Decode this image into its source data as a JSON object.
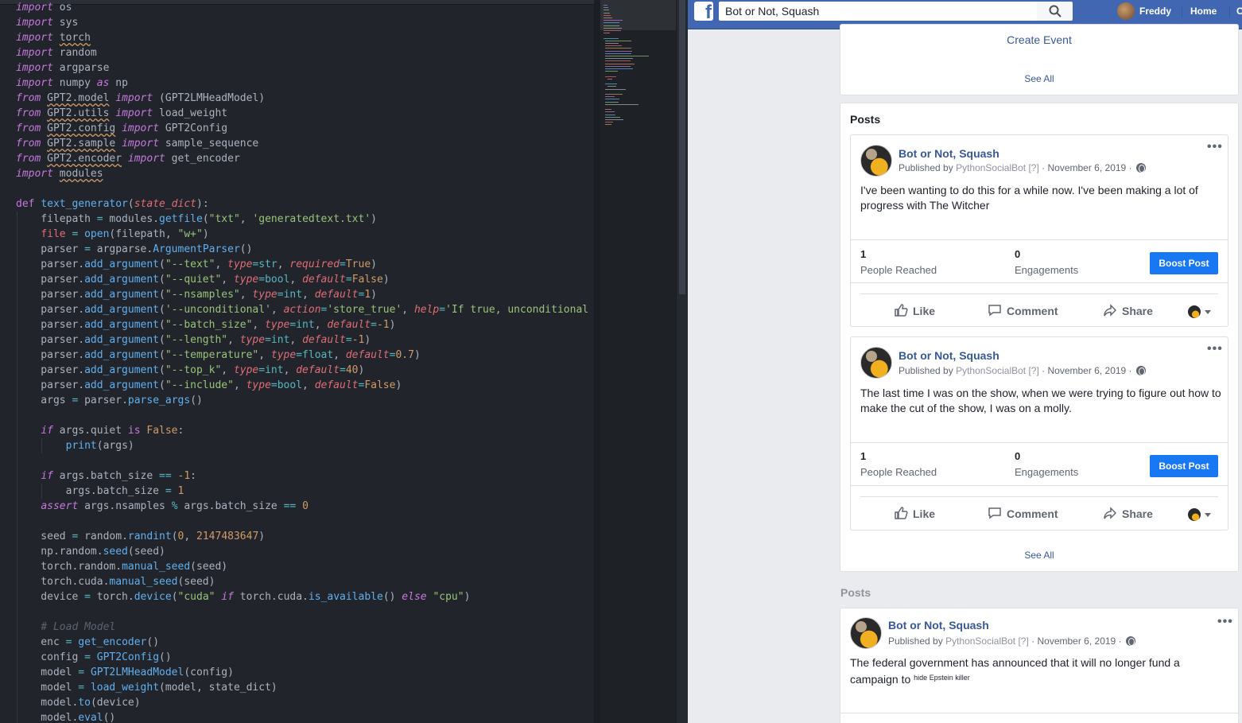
{
  "editor": {
    "code_lines": [
      "import os",
      "import sys",
      "import torch",
      "import random",
      "import argparse",
      "import numpy as np",
      "from GPT2.model import (GPT2LMHeadModel)",
      "from GPT2.utils import load_weight",
      "from GPT2.config import GPT2Config",
      "from GPT2.sample import sample_sequence",
      "from GPT2.encoder import get_encoder",
      "import modules",
      "",
      "def text_generator(state_dict):",
      "    filepath = modules.getfile(\"txt\", 'generatedtext.txt')",
      "    file = open(filepath, \"w+\")",
      "    parser = argparse.ArgumentParser()",
      "    parser.add_argument(\"--text\", type=str, required=True)",
      "    parser.add_argument(\"--quiet\", type=bool, default=False)",
      "    parser.add_argument(\"--nsamples\", type=int, default=1)",
      "    parser.add_argument('--unconditional', action='store_true', help='If true, unconditional ge",
      "    parser.add_argument(\"--batch_size\", type=int, default=-1)",
      "    parser.add_argument(\"--length\", type=int, default=-1)",
      "    parser.add_argument(\"--temperature\", type=float, default=0.7)",
      "    parser.add_argument(\"--top_k\", type=int, default=40)",
      "    parser.add_argument(\"--include\", type=bool, default=False)",
      "    args = parser.parse_args()",
      "",
      "    if args.quiet is False:",
      "        print(args)",
      "",
      "    if args.batch_size == -1:",
      "        args.batch_size = 1",
      "    assert args.nsamples % args.batch_size == 0",
      "",
      "    seed = random.randint(0, 2147483647)",
      "    np.random.seed(seed)",
      "    torch.random.manual_seed(seed)",
      "    torch.cuda.manual_seed(seed)",
      "    device = torch.device(\"cuda\" if torch.cuda.is_available() else \"cpu\")",
      "",
      "    # Load Model",
      "    enc = get_encoder()",
      "    config = GPT2Config()",
      "    model = GPT2LMHeadModel(config)",
      "    model = load_weight(model, state_dict)",
      "    model.to(device)",
      "    model.eval()"
    ],
    "theme": {
      "background": "#21252b",
      "keyword": "#c678dd",
      "function": "#61afef",
      "string": "#98c379",
      "number": "#d19a66",
      "param": "#e06c75",
      "text": "#abb2bf"
    }
  },
  "facebook": {
    "brand_color": "#4267b2",
    "logo_letter": "f",
    "search_value": "Bot or Not, Squash",
    "user_name": "Freddy",
    "nav_home": "Home",
    "nav_more": "C",
    "events_card": {
      "create_event": "Create Event",
      "see_all": "See All"
    },
    "posts_section": {
      "heading": "Posts",
      "see_all": "See All",
      "posts": [
        {
          "page_name": "Bot or Not, Squash",
          "published_by_prefix": "Published by",
          "publisher": "PythonSocialBot",
          "help_mark": "[?]",
          "date": "November 6, 2019",
          "text": "I've been wanting to do this for a while now. I've been making a lot of progress with The Witcher",
          "people_reached": "1",
          "people_reached_label": "People Reached",
          "engagements": "0",
          "engagements_label": "Engagements",
          "boost_label": "Boost Post",
          "like": "Like",
          "comment": "Comment",
          "share": "Share"
        },
        {
          "page_name": "Bot or Not, Squash",
          "published_by_prefix": "Published by",
          "publisher": "PythonSocialBot",
          "help_mark": "[?]",
          "date": "November 6, 2019",
          "text": "The last time I was on the show, when we were trying to figure out how to make the cut of the show, I was on a molly.",
          "people_reached": "1",
          "people_reached_label": "People Reached",
          "engagements": "0",
          "engagements_label": "Engagements",
          "boost_label": "Boost Post",
          "like": "Like",
          "comment": "Comment",
          "share": "Share"
        }
      ]
    },
    "posts_section_2": {
      "heading": "Posts",
      "post": {
        "page_name": "Bot or Not, Squash",
        "published_by_prefix": "Published by",
        "publisher": "PythonSocialBot",
        "help_mark": "[?]",
        "date": "November 6, 2019",
        "text": "The federal government has announced that it will no longer fund a campaign to",
        "tiny_text": "hide Epstein killer"
      }
    }
  }
}
